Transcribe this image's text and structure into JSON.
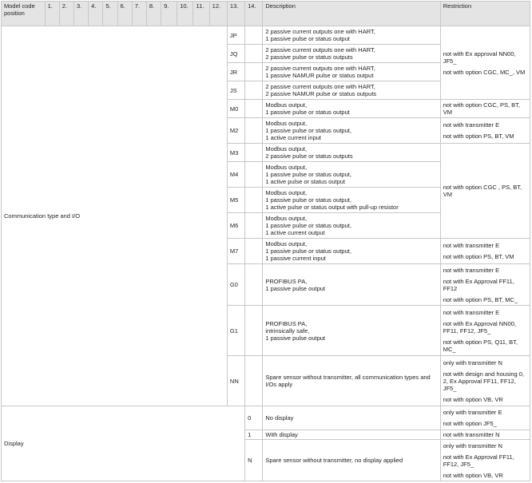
{
  "headers": [
    "Model code position",
    "1.",
    "2.",
    "3.",
    "4.",
    "5.",
    "6.",
    "7.",
    "8.",
    "9.",
    "10.",
    "11.",
    "12.",
    "13.",
    "14.",
    "Description",
    "Restriction"
  ],
  "groups": {
    "communication": {
      "label": "Communication type and I/O",
      "rows": [
        {
          "code": "JP",
          "desc": "2 passive current outputs one with HART,\n1 passive pulse or status output"
        },
        {
          "code": "JQ",
          "desc": "2 passive current outputs one with HART,\n2 passive pulse or status outputs"
        },
        {
          "code": "JR",
          "desc": "2 passive current outputs one with HART,\n1 passive NAMUR pulse or status output"
        },
        {
          "code": "JS",
          "desc": "2 passive current outputs one with HART,\n2 passive NAMUR pulse or status outputs"
        },
        {
          "code": "M0",
          "desc": "Modbus output,\n1 passive pulse or status output"
        },
        {
          "code": "M2",
          "desc": "Modbus output,\n1 passive pulse or status output,\n1 active current input"
        },
        {
          "code": "M3",
          "desc": "Modbus output,\n2 passive pulse or status outputs"
        },
        {
          "code": "M4",
          "desc": "Modbus output,\n1 passive pulse or status output,\n1 active pulse or status output"
        },
        {
          "code": "M5",
          "desc": "Modbus output,\n1 passive pulse or status output,\n1 active pulse or status output with pull-up resistor"
        },
        {
          "code": "M6",
          "desc": "Modbus output,\n1 passive pulse or status output,\n1 active current output"
        },
        {
          "code": "M7",
          "desc": "Modbus output,\n1 passive pulse or status output,\n1 passive current input"
        },
        {
          "code": "G0",
          "desc": "PROFIBUS PA,\n1 passive pulse output"
        },
        {
          "code": "G1",
          "desc": "PROFIBUS PA,\nintrinsically safe,\n1 passive pulse output"
        },
        {
          "code": "NN",
          "desc": "Spare sensor without transmitter, all communication types and I/Os apply"
        }
      ],
      "restrictions": {
        "j_group": [
          "not with Ex approval NN00, JF5_",
          "not with option CGC, MC_, VM"
        ],
        "m0": [
          "not with option CGC, PS, BT, VM"
        ],
        "m2": [
          "not with transmitter E",
          "not with option PS, BT, VM"
        ],
        "m3_m6": [
          "not with option CGC , PS, BT, VM"
        ],
        "m7": [
          "not with transmitter E",
          "not with option PS, BT, VM"
        ],
        "g0": [
          "not with transmitter E",
          "not with Ex Approval FF11, FF12",
          "not with option PS, BT, MC_"
        ],
        "g1": [
          "not with transmitter E",
          "not with Ex Approval NN00, FF11, FF12, JF5_",
          "not with option PS, Q11, BT, MC_"
        ],
        "nn": [
          "only with transmitter N",
          "not with design and housing 0, 2, Ex Approval FF11, FF12, JF5_",
          "not with option VB, VR"
        ]
      }
    },
    "display": {
      "label": "Display",
      "rows": [
        {
          "code": "0",
          "desc": "No display",
          "restrictions": [
            "only with transmitter E",
            "not with option JF5_"
          ]
        },
        {
          "code": "1",
          "desc": "With display",
          "restrictions": [
            "not with transmitter N"
          ]
        },
        {
          "code": "N",
          "desc": "Spare sensor without transmitter, no display applied",
          "restrictions": [
            "only with transmitter N",
            "not with Ex Approval FF11, FF12, JF5_",
            "not with option VB, VR"
          ]
        }
      ]
    }
  }
}
